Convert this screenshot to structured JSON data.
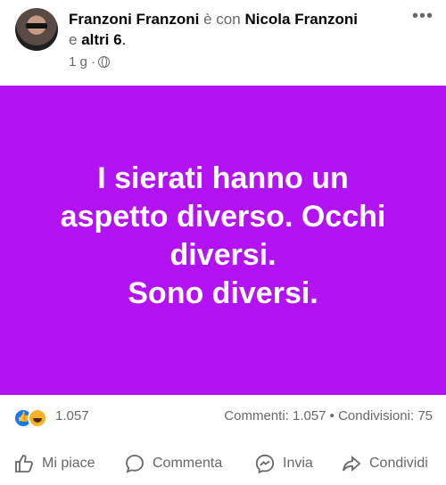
{
  "post": {
    "author": "Franzoni Franzoni",
    "with_text": "è con",
    "tagged": "Nicola Franzoni",
    "and_text": "e",
    "others": "altri 6",
    "period": ".",
    "time": "1 g ·",
    "text": "I sierati hanno un\naspetto diverso. Occhi\ndiversi.\nSono diversi.",
    "background_color": "#b212f4"
  },
  "stats": {
    "reactions_count": "1.057",
    "comments_shares": "Commenti: 1.057 • Condivisioni: 75"
  },
  "actions": {
    "like": "Mi piace",
    "comment": "Commenta",
    "send": "Invia",
    "share": "Condividi"
  },
  "icons": [
    "avatar",
    "globe-icon",
    "more-icon",
    "like-reaction-icon",
    "haha-reaction-icon",
    "thumb-up-icon",
    "comment-icon",
    "messenger-icon",
    "share-icon"
  ]
}
